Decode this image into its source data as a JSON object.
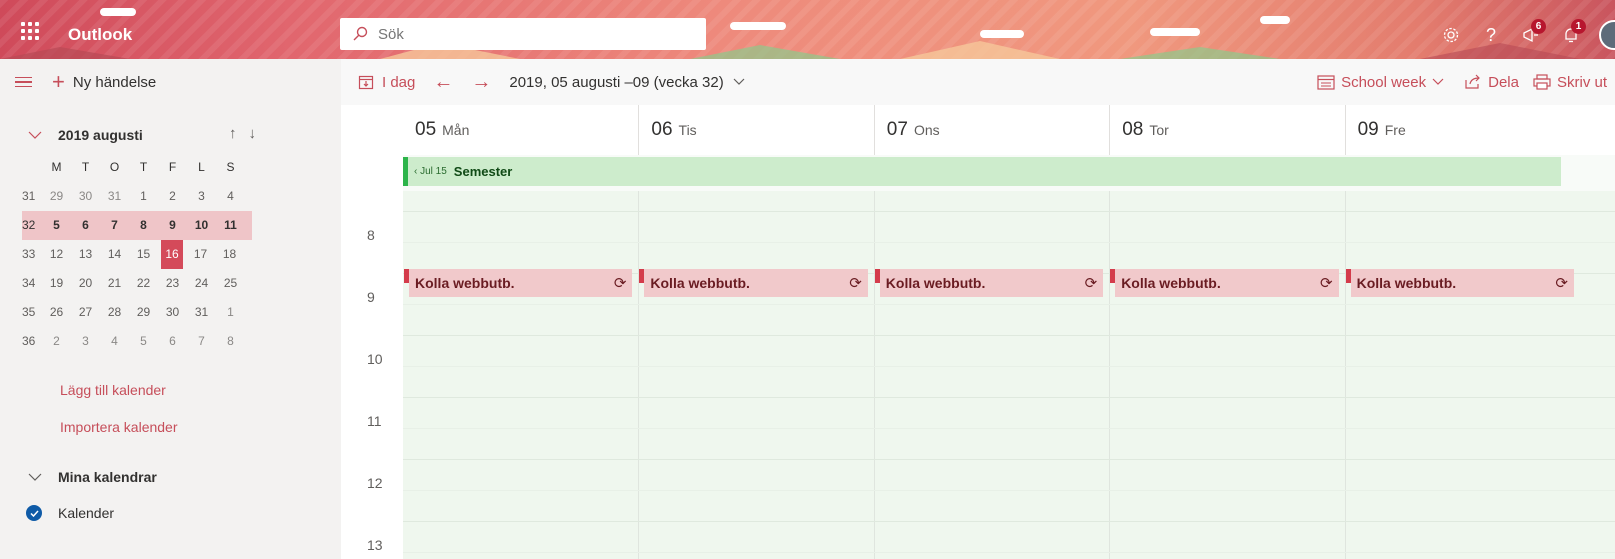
{
  "colors": {
    "accent": "#c64e5a",
    "today": "#d44a5a",
    "selected_week": "#efc5c8",
    "allday_event": "#cdeccc",
    "event": "#f1c9cb",
    "check": "#0f5ba7"
  },
  "header": {
    "brand": "Outlook",
    "search_placeholder": "Sök",
    "icons": [
      "gear-icon",
      "help-icon",
      "megaphone-icon",
      "bell-icon"
    ],
    "badges": {
      "megaphone": "6",
      "bell": "1"
    },
    "help_label": "?"
  },
  "command": {
    "new_event": "Ny händelse",
    "today": "I dag",
    "date_range": "2019, 05 augusti –09 (vecka 32)",
    "view": "School week",
    "share": "Dela",
    "print": "Skriv ut"
  },
  "mini_calendar": {
    "title": "2019 augusti",
    "weekday_headers": [
      "M",
      "T",
      "O",
      "T",
      "F",
      "L",
      "S"
    ],
    "rows": [
      {
        "week": "31",
        "days": [
          "29",
          "30",
          "31",
          "1",
          "2",
          "3",
          "4"
        ]
      },
      {
        "week": "32",
        "days": [
          "5",
          "6",
          "7",
          "8",
          "9",
          "10",
          "11"
        ],
        "selected": true
      },
      {
        "week": "33",
        "days": [
          "12",
          "13",
          "14",
          "15",
          "16",
          "17",
          "18"
        ]
      },
      {
        "week": "34",
        "days": [
          "19",
          "20",
          "21",
          "22",
          "23",
          "24",
          "25"
        ]
      },
      {
        "week": "35",
        "days": [
          "26",
          "27",
          "28",
          "29",
          "30",
          "31",
          "1"
        ]
      },
      {
        "week": "36",
        "days": [
          "2",
          "3",
          "4",
          "5",
          "6",
          "7",
          "8"
        ]
      }
    ],
    "today": "16"
  },
  "links": {
    "add_calendar": "Lägg till kalender",
    "import_calendar": "Importera kalender"
  },
  "my_calendars": {
    "title": "Mina kalendrar",
    "items": [
      {
        "name": "Kalender",
        "checked": true
      }
    ]
  },
  "days": [
    {
      "num": "05",
      "name": "Mån"
    },
    {
      "num": "06",
      "name": "Tis"
    },
    {
      "num": "07",
      "name": "Ons"
    },
    {
      "num": "08",
      "name": "Tor"
    },
    {
      "num": "09",
      "name": "Fre"
    }
  ],
  "hours": [
    "8",
    "9",
    "10",
    "11",
    "12",
    "13"
  ],
  "all_day_event": {
    "since": "Jul 15",
    "title": "Semester"
  },
  "events": [
    {
      "day": 0,
      "title": "Kolla webbutb."
    },
    {
      "day": 1,
      "title": "Kolla webbutb."
    },
    {
      "day": 2,
      "title": "Kolla webbutb."
    },
    {
      "day": 3,
      "title": "Kolla webbutb."
    },
    {
      "day": 4,
      "title": "Kolla webbutb."
    }
  ]
}
